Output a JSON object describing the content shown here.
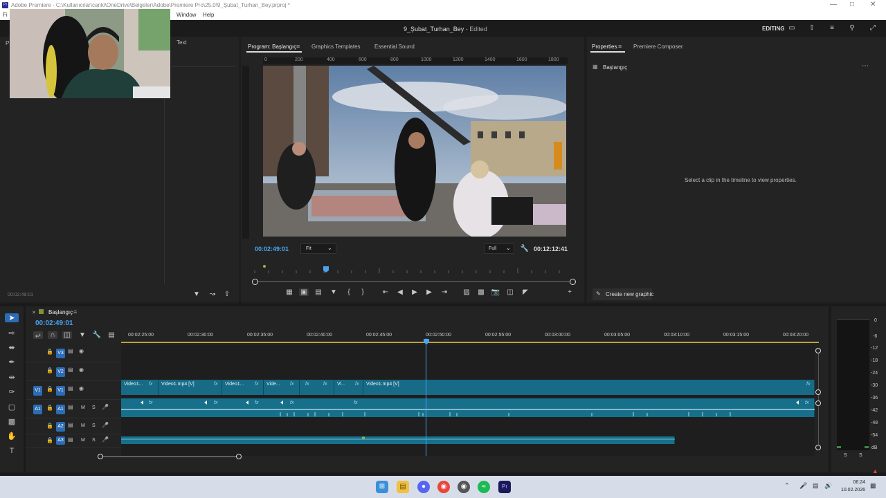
{
  "window": {
    "app_icon": "Pr",
    "title": "Adobe Premiere - C:\\Kullanıcılar\\canki\\OneDrive\\Belgeler\\Adobe\\Premiere Pro\\25.0\\9_Şubat_Turhan_Bey.prproj *"
  },
  "menu": {
    "file_partial": "Fi",
    "items": [
      "Window",
      "Help"
    ]
  },
  "header": {
    "project_title": "9_Şubat_Turhan_Bey",
    "status": "- Edited",
    "workspace_label": "EDITING"
  },
  "left_panel": {
    "tab_partial": "P",
    "text_tab": "Text",
    "timecode": "00:02:49:01"
  },
  "program_monitor": {
    "tabs": [
      "Program: Başlangıç",
      "Graphics Templates",
      "Essential Sound"
    ],
    "ruler_labels": [
      "0",
      "200",
      "400",
      "600",
      "800",
      "1000",
      "1200",
      "1400",
      "1600",
      "1800"
    ],
    "timecode": "00:02:49:01",
    "fit_label": "Fit",
    "quality_label": "Full",
    "duration": "00:12:12:41"
  },
  "properties": {
    "tabs": [
      "Properties",
      "Premiere Composer"
    ],
    "sequence_name": "Başlangıç",
    "empty_message": "Select a clip in the timeline to view properties.",
    "create_graphic_label": "Create new graphic"
  },
  "timeline": {
    "sequence_tab": "Başlangıç",
    "timecode": "00:02:49:01",
    "ruler_labels": [
      "00:02:25:00",
      "00:02:30:00",
      "00:02:35:00",
      "00:02:40:00",
      "00:02:45:00",
      "00:02:50:00",
      "00:02:55:00",
      "00:03:00:00",
      "00:03:05:00",
      "00:03:10:00",
      "00:03:15:00",
      "00:03:20:00"
    ],
    "tracks": [
      {
        "src": "",
        "name": "V3",
        "type": "video"
      },
      {
        "src": "",
        "name": "V2",
        "type": "video"
      },
      {
        "src": "V1",
        "name": "V1",
        "type": "video"
      },
      {
        "src": "A1",
        "name": "A1",
        "type": "audio"
      },
      {
        "src": "",
        "name": "A2",
        "type": "audio"
      },
      {
        "src": "",
        "name": "A3",
        "type": "audio"
      }
    ],
    "mute_label": "M",
    "solo_label": "S",
    "video_clips": [
      "Video1...",
      "Video1.mp4 [V]",
      "Video1...",
      "Vide...",
      "Vi...",
      "Video1.mp4 [V]"
    ],
    "fx_label": "fx"
  },
  "meter": {
    "labels": [
      "0",
      "-6",
      "-12",
      "-18",
      "-24",
      "-30",
      "-36",
      "-42",
      "-48",
      "-54",
      "dB"
    ],
    "solo_labels": [
      "S",
      "S"
    ]
  },
  "taskbar": {
    "time": "06:24",
    "date": "10.02.2026",
    "apps": [
      "windows-icon",
      "file-explorer-icon",
      "discord-icon",
      "chrome-icon",
      "chrome-alt-icon",
      "spotify-icon",
      "premiere-icon"
    ]
  }
}
